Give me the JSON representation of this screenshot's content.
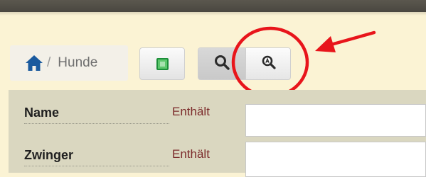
{
  "breadcrumb": {
    "home_icon": "home-icon",
    "separator": "/",
    "label": "Hunde"
  },
  "toolbar": {
    "green_button_icon": "green-square-icon",
    "search_button_icon": "search-icon",
    "advanced_search_button_icon": "advanced-search-icon"
  },
  "filters": [
    {
      "label": "Name",
      "operator": "Enthält",
      "value": ""
    },
    {
      "label": "Zwinger",
      "operator": "Enthält",
      "value": ""
    }
  ],
  "annotation": {
    "color": "#e8151b",
    "shapes": [
      "circle",
      "arrow"
    ]
  },
  "colors": {
    "page_bg": "#fbf3d4",
    "topbar": "#55524a",
    "filter_panel": "#dad7c0",
    "operator_text": "#7c2b2b",
    "home_icon": "#1a5a9e"
  }
}
